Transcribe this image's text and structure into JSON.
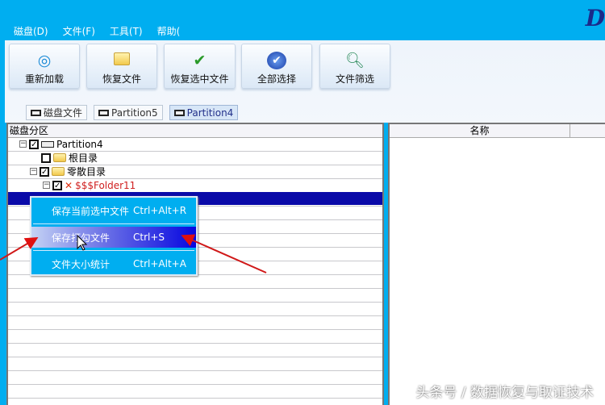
{
  "logo": "D",
  "menu": [
    "磁盘(D)",
    "文件(F)",
    "工具(T)",
    "帮助("
  ],
  "toolbar": [
    {
      "label": "重新加载",
      "icon": "reload-icon"
    },
    {
      "label": "恢复文件",
      "icon": "folder-icon"
    },
    {
      "label": "恢复选中文件",
      "icon": "folder-check-icon"
    },
    {
      "label": "全部选择",
      "icon": "select-all-icon"
    },
    {
      "label": "文件筛选",
      "icon": "filter-icon"
    }
  ],
  "tabs": [
    "磁盘文件",
    "Partition5",
    "Partition4"
  ],
  "left_panel": {
    "header": "磁盘分区",
    "tree": [
      "Partition4",
      "根目录",
      "零散目录",
      "$$$Folder11"
    ]
  },
  "right_panel": {
    "header": "名称"
  },
  "context_menu": [
    {
      "label": "保存当前选中文件",
      "shortcut": "Ctrl+Alt+R"
    },
    {
      "label": "保存打勾文件",
      "shortcut": "Ctrl+S"
    },
    {
      "label": "文件大小统计",
      "shortcut": "Ctrl+Alt+A"
    }
  ],
  "watermark": "头条号 / 数据恢复与取证技术"
}
